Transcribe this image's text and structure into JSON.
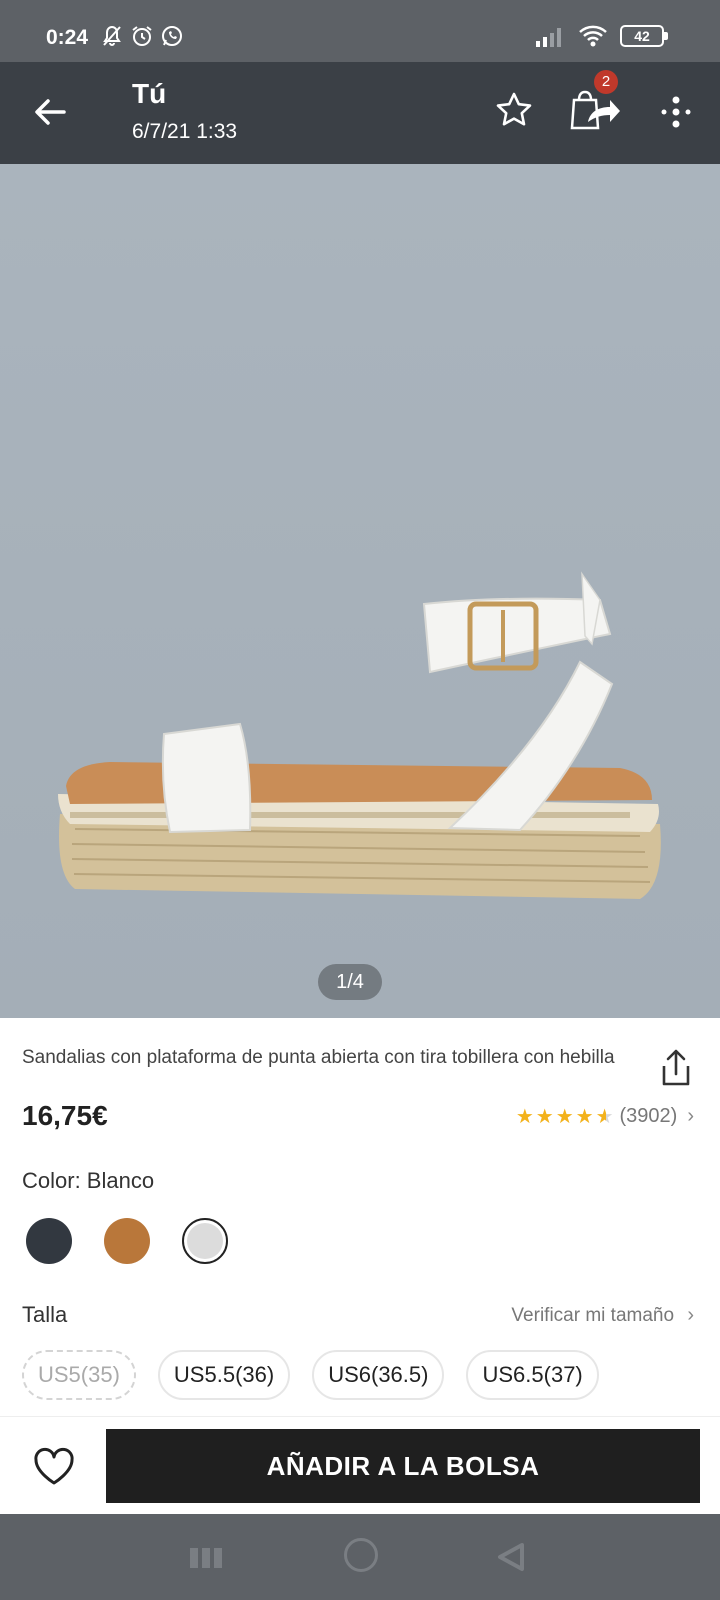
{
  "status_bar": {
    "time": "0:24",
    "battery": "42"
  },
  "app_bar": {
    "title": "Tú",
    "subtitle": "6/7/21 1:33",
    "bag_count": "2"
  },
  "gallery": {
    "counter": "1/4"
  },
  "product": {
    "title": "Sandalias con plataforma de punta abierta con tira tobillera con hebilla",
    "price": "16,75€",
    "rating_stars": 4.5,
    "review_count": "(3902)"
  },
  "color": {
    "label": "Color: Blanco",
    "swatches": [
      {
        "name": "black",
        "hex": "#323840"
      },
      {
        "name": "tan",
        "hex": "#b9773a"
      },
      {
        "name": "white",
        "hex": "#dcdcdc",
        "selected": true
      }
    ]
  },
  "size": {
    "label": "Talla",
    "check_link": "Verificar mi tamaño",
    "options": [
      {
        "label": "US5(35)",
        "available": false
      },
      {
        "label": "US5.5(36)",
        "available": true
      },
      {
        "label": "US6(36.5)",
        "available": true
      },
      {
        "label": "US6.5(37)",
        "available": true
      }
    ]
  },
  "actions": {
    "add_to_bag": "AÑADIR A LA BOLSA"
  }
}
